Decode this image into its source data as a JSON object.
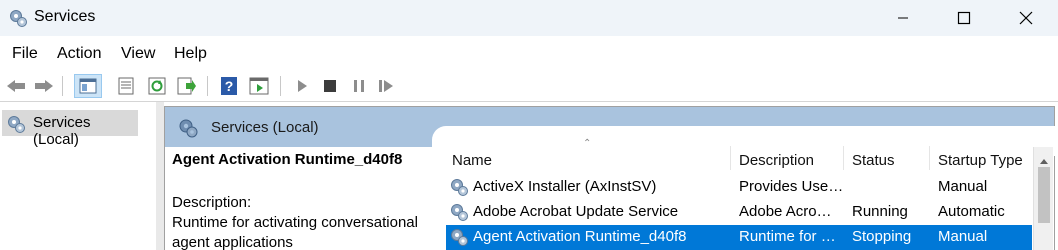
{
  "window": {
    "title": "Services",
    "icon": "gears-icon",
    "controls": [
      "minimize-icon",
      "maximize-icon",
      "close-icon"
    ]
  },
  "menu": [
    "File",
    "Action",
    "View",
    "Help"
  ],
  "toolbar": {
    "buttons": [
      "back-icon",
      "forward-icon",
      "show-hide-tree-icon",
      "properties-icon",
      "refresh-icon",
      "export-list-icon",
      "help-icon",
      "show-hide-action-pane-icon",
      "start-service-icon",
      "stop-service-icon",
      "pause-service-icon",
      "restart-service-icon"
    ]
  },
  "tree": {
    "items": [
      {
        "label": "Services (Local)",
        "selected": true
      }
    ]
  },
  "header": {
    "label": "Services (Local)"
  },
  "detail": {
    "title": "Agent Activation Runtime_d40f8",
    "description_heading": "Description:",
    "description": "Runtime for activating conversational agent applications"
  },
  "list": {
    "columns": [
      "Name",
      "Description",
      "Status",
      "Startup Type"
    ],
    "sorted_column": "Name",
    "rows": [
      {
        "name": "ActiveX Installer (AxInstSV)",
        "description": "Provides Use…",
        "status": "",
        "startup": "Manual",
        "selected": false
      },
      {
        "name": "Adobe Acrobat Update Service",
        "description": "Adobe Acro…",
        "status": "Running",
        "startup": "Automatic",
        "selected": false
      },
      {
        "name": "Agent Activation Runtime_d40f8",
        "description": "Runtime for …",
        "status": "Stopping",
        "startup": "Manual",
        "selected": true
      }
    ]
  },
  "colors": {
    "header_bg": "#a9c3de",
    "selection": "#0078d7",
    "titlebar": "#eff4f9"
  }
}
